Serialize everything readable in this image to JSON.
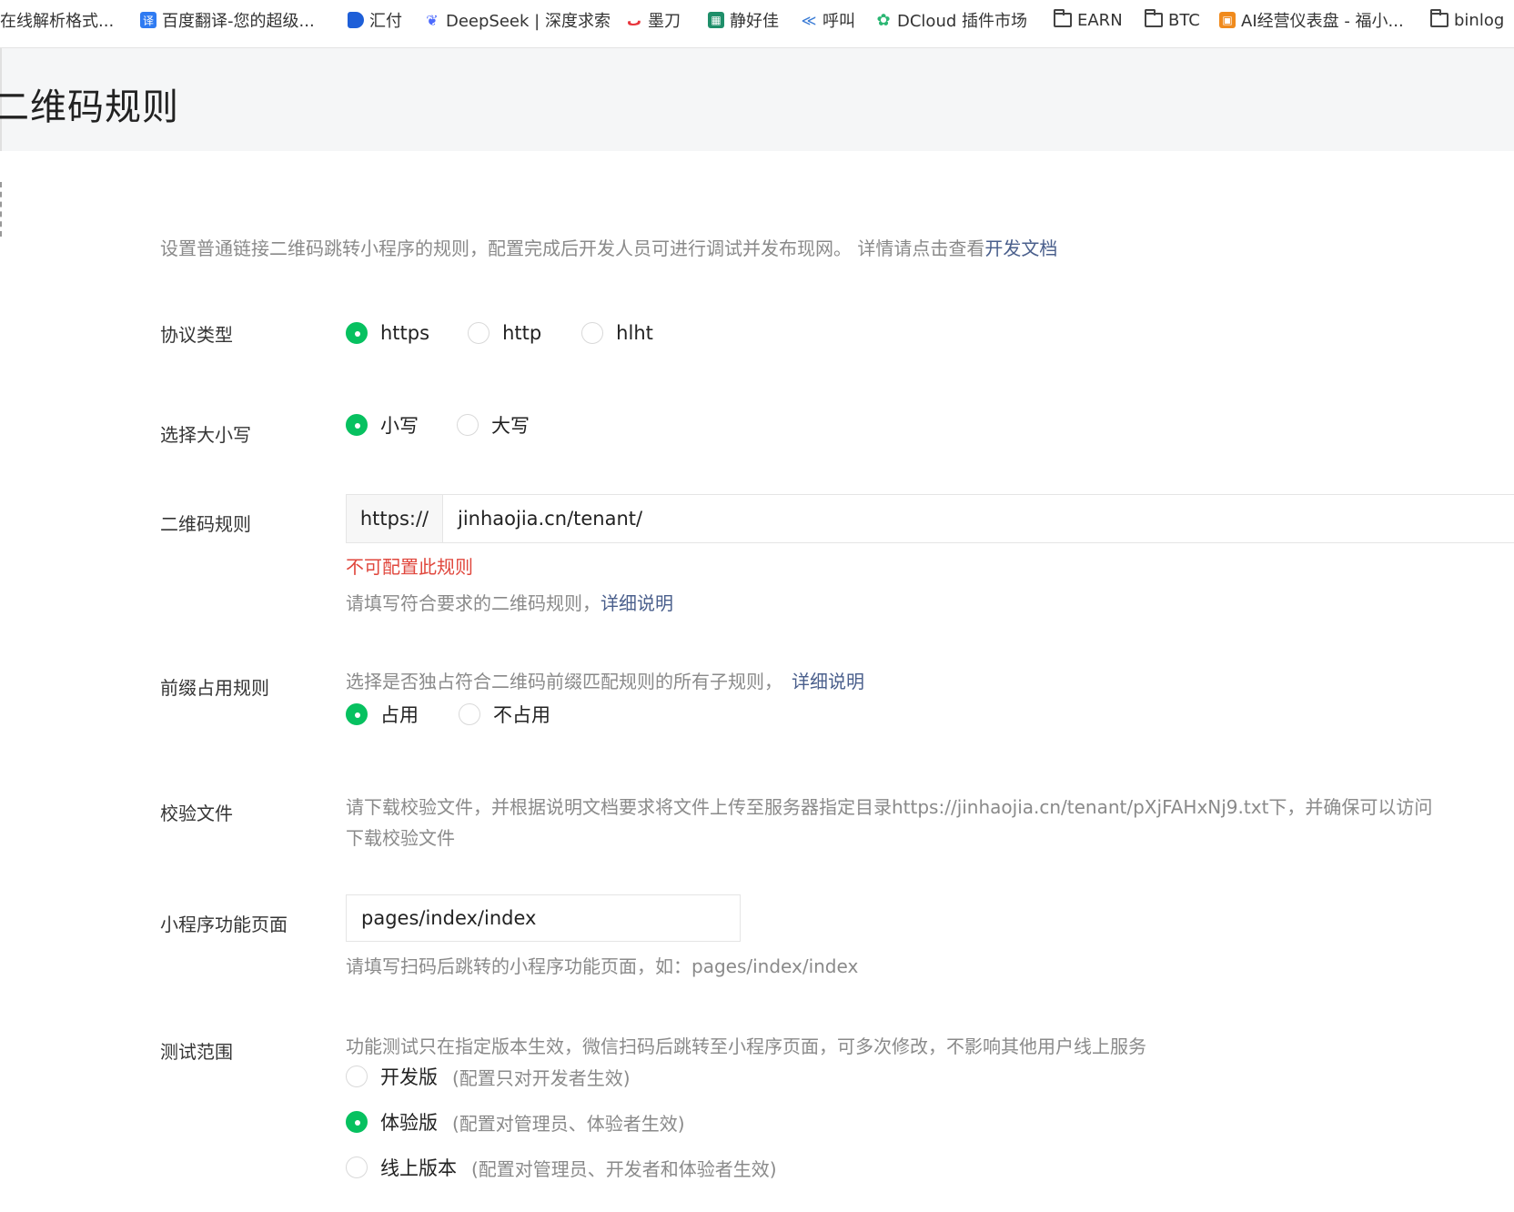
{
  "bookmarks": [
    {
      "label": "在线解析格式...",
      "icon": "document-icon",
      "color": "#3d7ad6"
    },
    {
      "label": "百度翻译-您的超级...",
      "icon": "translate-icon",
      "color": "#2f7bf2"
    },
    {
      "label": "汇付",
      "icon": "huifu-icon",
      "color": "#1e5fd8"
    },
    {
      "label": "DeepSeek | 深度求索",
      "icon": "whale-icon",
      "color": "#4d6bfe"
    },
    {
      "label": "墨刀",
      "icon": "modao-icon",
      "color": "#e8343b"
    },
    {
      "label": "静好佳",
      "icon": "jinghaojia-icon",
      "color": "#1f8f6a"
    },
    {
      "label": "呼叫",
      "icon": "call-icon",
      "color": "#3a7bd5"
    },
    {
      "label": "DCloud 插件市场",
      "icon": "dcloud-icon",
      "color": "#2bb673"
    },
    {
      "label": "EARN",
      "icon": "folder-icon",
      "color": "#444444"
    },
    {
      "label": "BTC",
      "icon": "folder-icon",
      "color": "#444444"
    },
    {
      "label": "AI经营仪表盘 - 福小...",
      "icon": "dashboard-icon",
      "color": "#f08a1c"
    },
    {
      "label": "binlog",
      "icon": "folder-icon",
      "color": "#444444"
    }
  ],
  "header": {
    "title": "二维码规则"
  },
  "description": {
    "text": "设置普通链接二维码跳转小程序的规则，配置完成后开发人员可进行调试并发布现网。 详情请点击查看",
    "link": "开发文档"
  },
  "protocol": {
    "label": "协议类型",
    "options": [
      {
        "label": "https",
        "checked": true
      },
      {
        "label": "http",
        "checked": false
      },
      {
        "label": "hlht",
        "checked": false
      }
    ]
  },
  "case": {
    "label": "选择大小写",
    "options": [
      {
        "label": "小写",
        "checked": true
      },
      {
        "label": "大写",
        "checked": false
      }
    ]
  },
  "qr_rule": {
    "label": "二维码规则",
    "prefix": "https://",
    "value": "jinhaojia.cn/tenant/",
    "error": "不可配置此规则",
    "hint": "请填写符合要求的二维码规则，",
    "hint_link": "详细说明"
  },
  "prefix_rule": {
    "label": "前缀占用规则",
    "hint": "选择是否独占符合二维码前缀匹配规则的所有子规则，",
    "hint_link": "详细说明",
    "options": [
      {
        "label": "占用",
        "checked": true
      },
      {
        "label": "不占用",
        "checked": false
      }
    ]
  },
  "verify_file": {
    "label": "校验文件",
    "text": "请下载校验文件，并根据说明文档要求将文件上传至服务器指定目录https://jinhaojia.cn/tenant/pXjFAHxNj9.txt下，并确保可以访问",
    "download_link": "下载校验文件"
  },
  "mini_page": {
    "label": "小程序功能页面",
    "value": "pages/index/index",
    "hint": "请填写扫码后跳转的小程序功能页面，如：pages/index/index"
  },
  "test_scope": {
    "label": "测试范围",
    "hint": "功能测试只在指定版本生效，微信扫码后跳转至小程序页面，可多次修改，不影响其他用户线上服务",
    "options": [
      {
        "label": "开发版",
        "note": "(配置只对开发者生效)",
        "checked": false
      },
      {
        "label": "体验版",
        "note": "(配置对管理员、体验者生效)",
        "checked": true
      },
      {
        "label": "线上版本",
        "note": "(配置对管理员、开发者和体验者生效)",
        "checked": false
      }
    ]
  },
  "colors": {
    "accent": "#07c160",
    "error": "#e0473d",
    "link": "#4a5f8c",
    "muted": "#8a8a8a"
  }
}
